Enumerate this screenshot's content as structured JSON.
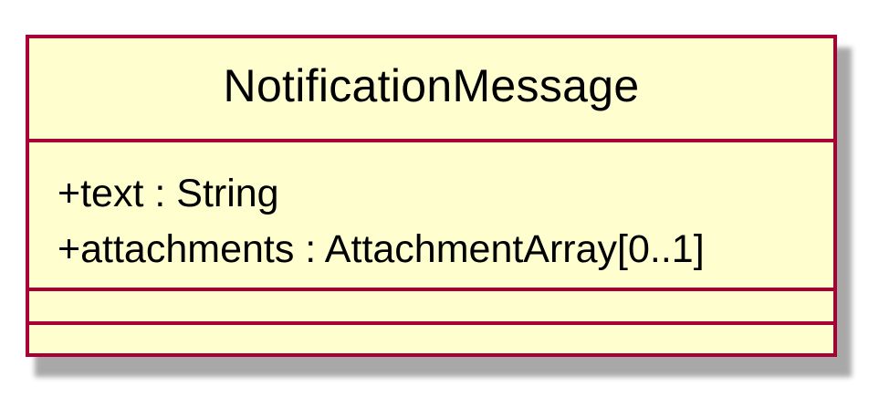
{
  "diagram": {
    "class_name": "NotificationMessage",
    "attributes": [
      "+text : String",
      "+attachments : AttachmentArray[0..1]"
    ],
    "methods": [],
    "colors": {
      "fill": "#FEFECE",
      "border": "#A80036",
      "shadow": "#9a9a9a"
    }
  }
}
